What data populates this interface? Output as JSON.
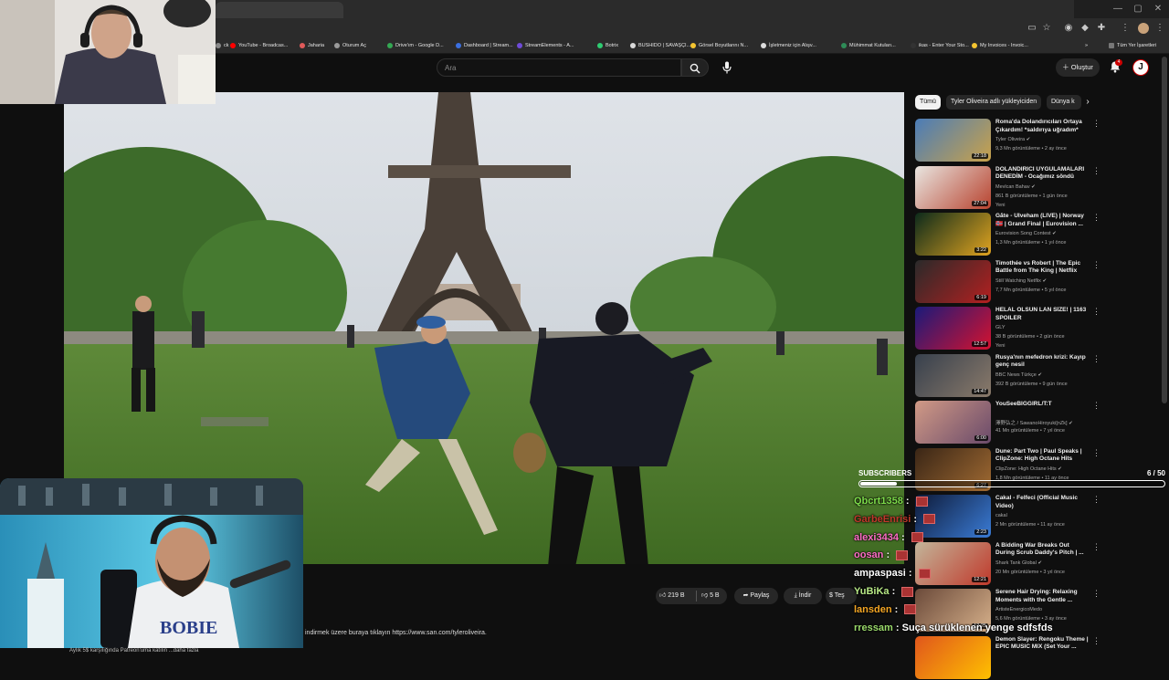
{
  "browser": {
    "bookmarks": [
      {
        "label": "ck",
        "color": "#888888"
      },
      {
        "label": "YouTube - Broadcas...",
        "color": "#ff0000"
      },
      {
        "label": "Jaharia",
        "color": "#e05a5a"
      },
      {
        "label": "Oturum Aç",
        "color": "#9a9a9a"
      },
      {
        "label": "Drive'ım - Google D...",
        "color": "#34a853"
      },
      {
        "label": "Dashboard | Stream...",
        "color": "#3b6fe0"
      },
      {
        "label": "StreamElements - A...",
        "color": "#6f4bd8"
      },
      {
        "label": "Botrix",
        "color": "#2ecc71"
      },
      {
        "label": "BUSHIDO | SAVAŞÇI...",
        "color": "#d9d9d9"
      },
      {
        "label": "Görsel Boyutlarını N...",
        "color": "#f4c430"
      },
      {
        "label": "İşletmeniz için Alışv...",
        "color": "#dddddd"
      },
      {
        "label": "Mühimmat Kutuları...",
        "color": "#2e8b57"
      },
      {
        "label": "ikas - Enter Your Sto...",
        "color": "#333333"
      },
      {
        "label": "My Invoices - Invoic...",
        "color": "#f4c430"
      }
    ],
    "all_bookmarks": "Tüm Yer İşaretleri"
  },
  "header": {
    "search_placeholder": "Ara",
    "create_label": "Oluştur",
    "notification_count": "4",
    "avatar_letter": "J"
  },
  "actions": {
    "likes": "219 B",
    "dislikes": "5 B",
    "share": "Paylaş",
    "download": "İndir",
    "thanks": "Teş"
  },
  "description": {
    "line": "indirmek üzere buraya tıklayın https://www.san.com/tyleroliveira.",
    "patreon": "Aylık 5$ karşılığında Patreon'uma katılın ...daha fazla"
  },
  "chips": [
    "Tümü",
    "Tyler Oliveira adlı yükleyiciden",
    "Dünya k"
  ],
  "recommendations": [
    {
      "title": "Roma'da Dolandırıcıları Ortaya Çıkardım! *saldırıya uğradım*",
      "channel": "Tyler Oliveira",
      "verified": true,
      "meta": "9,3 Mn görüntüleme • 2 ay önce",
      "badge": "",
      "duration": "22:18",
      "thumb": [
        "#4a7cb8",
        "#c9a24a"
      ]
    },
    {
      "title": "DOLANDIRICI UYGULAMALARI DENEDİM - Ocağımız söndü",
      "channel": "Mevlcan Bahav",
      "verified": true,
      "meta": "861 B görüntüleme • 1 gün önce",
      "badge": "Yeni",
      "duration": "27:04",
      "thumb": [
        "#e9e6e1",
        "#b8432f"
      ]
    },
    {
      "title": "Gåte - Ulveham (LIVE) | Norway 🇳🇴 | Grand Final | Eurovision ...",
      "channel": "Eurovision Song Contest",
      "verified": true,
      "meta": "1,3 Mn görüntüleme • 1 yıl önce",
      "badge": "",
      "duration": "3:22",
      "thumb": [
        "#0c2a1b",
        "#e0a320"
      ]
    },
    {
      "title": "Timothée vs Robert | The Epic Battle from The King | Netflix",
      "channel": "Still Watching Netflix",
      "verified": true,
      "meta": "7,7 Mn görüntüleme • 5 yıl önce",
      "badge": "",
      "duration": "6:19",
      "thumb": [
        "#2a2a2a",
        "#b32020"
      ]
    },
    {
      "title": "HELAL OLSUN LAN SİZE! | 1163 SPOILER",
      "channel": "GLY",
      "verified": false,
      "meta": "38 B görüntüleme • 2 gün önce",
      "badge": "Yeni",
      "duration": "12:57",
      "thumb": [
        "#1a1a7a",
        "#d4122f"
      ]
    },
    {
      "title": "Rusya'nın mefedron krizi: Kayıp genç nesil",
      "channel": "BBC News Türkçe",
      "verified": true,
      "meta": "392 B görüntüleme • 9 gün önce",
      "badge": "",
      "duration": "14:47",
      "thumb": [
        "#37404d",
        "#8a7a6a"
      ]
    },
    {
      "title": "YouSeeBIGGIRL/T:T",
      "channel": "澤野弘之 / SawanoHiroyuki[nZk]",
      "verified": true,
      "meta": "41 Mn görüntüleme • 7 yıl önce",
      "badge": "",
      "duration": "6:00",
      "thumb": [
        "#d19a86",
        "#6a4a6a"
      ]
    },
    {
      "title": "Dune: Part Two | Paul Speaks | ClipZone: High Octane Hits",
      "channel": "ClipZone: High Octane Hits",
      "verified": true,
      "meta": "1,8 Mn görüntüleme • 11 ay önce",
      "badge": "",
      "duration": "6:27",
      "thumb": [
        "#3a2616",
        "#a06a32"
      ]
    },
    {
      "title": "Cakal - Felfeci (Official Music Video)",
      "channel": "cakal",
      "verified": false,
      "meta": "2 Mn görüntüleme • 11 ay önce",
      "badge": "",
      "duration": "2:23",
      "thumb": [
        "#0e1a38",
        "#3a7bd5"
      ]
    },
    {
      "title": "A Bidding War Breaks Out During Scrub Daddy's Pitch | ...",
      "channel": "Shark Tank Global",
      "verified": true,
      "meta": "20 Mn görüntüleme • 3 yıl önce",
      "badge": "",
      "duration": "12:21",
      "thumb": [
        "#c3b59a",
        "#c0392b"
      ]
    },
    {
      "title": "Serene Hair Drying: Relaxing Moments with the Gentle ...",
      "channel": "ArtisteEnergicoMedo",
      "verified": false,
      "meta": "5,6 Mn görüntüleme • 3 ay önce",
      "badge": "",
      "duration": "12:25",
      "thumb": [
        "#6b4a3a",
        "#d6b08a"
      ]
    },
    {
      "title": "Demon Slayer: Rengoku Theme | EPIC MUSIC MIX (Set Your ...",
      "channel": "",
      "verified": false,
      "meta": "",
      "badge": "",
      "duration": "",
      "thumb": [
        "#e0561c",
        "#ffc000"
      ]
    }
  ],
  "overlay": {
    "subs_label": "SUBSCRIBERS",
    "subs_count": "6 / 50",
    "subs_progress": 0.12,
    "chat": [
      {
        "user": "Qbcrt1358",
        "color": "#7ddc4a",
        "message": "",
        "emote": true
      },
      {
        "user": "GarbeEnrisi",
        "color": "#c0392b",
        "message": "",
        "emote": true
      },
      {
        "user": "alexi3434",
        "color": "#ff6ec7",
        "message": "",
        "emote": true
      },
      {
        "user": "oosan",
        "color": "#ff6ec7",
        "message": "",
        "emote": true
      },
      {
        "user": "ampaspasi",
        "color": "#ffffff",
        "message": "",
        "emote": true
      },
      {
        "user": "YuBiKa",
        "color": "#b8e986",
        "message": "",
        "emote": true
      },
      {
        "user": "lansden",
        "color": "#f5a623",
        "message": "",
        "emote": true
      },
      {
        "user": "rressam",
        "color": "#9ad96a",
        "message": "Suça sürüklenen yenge sdfsfds",
        "emote": false
      }
    ]
  }
}
